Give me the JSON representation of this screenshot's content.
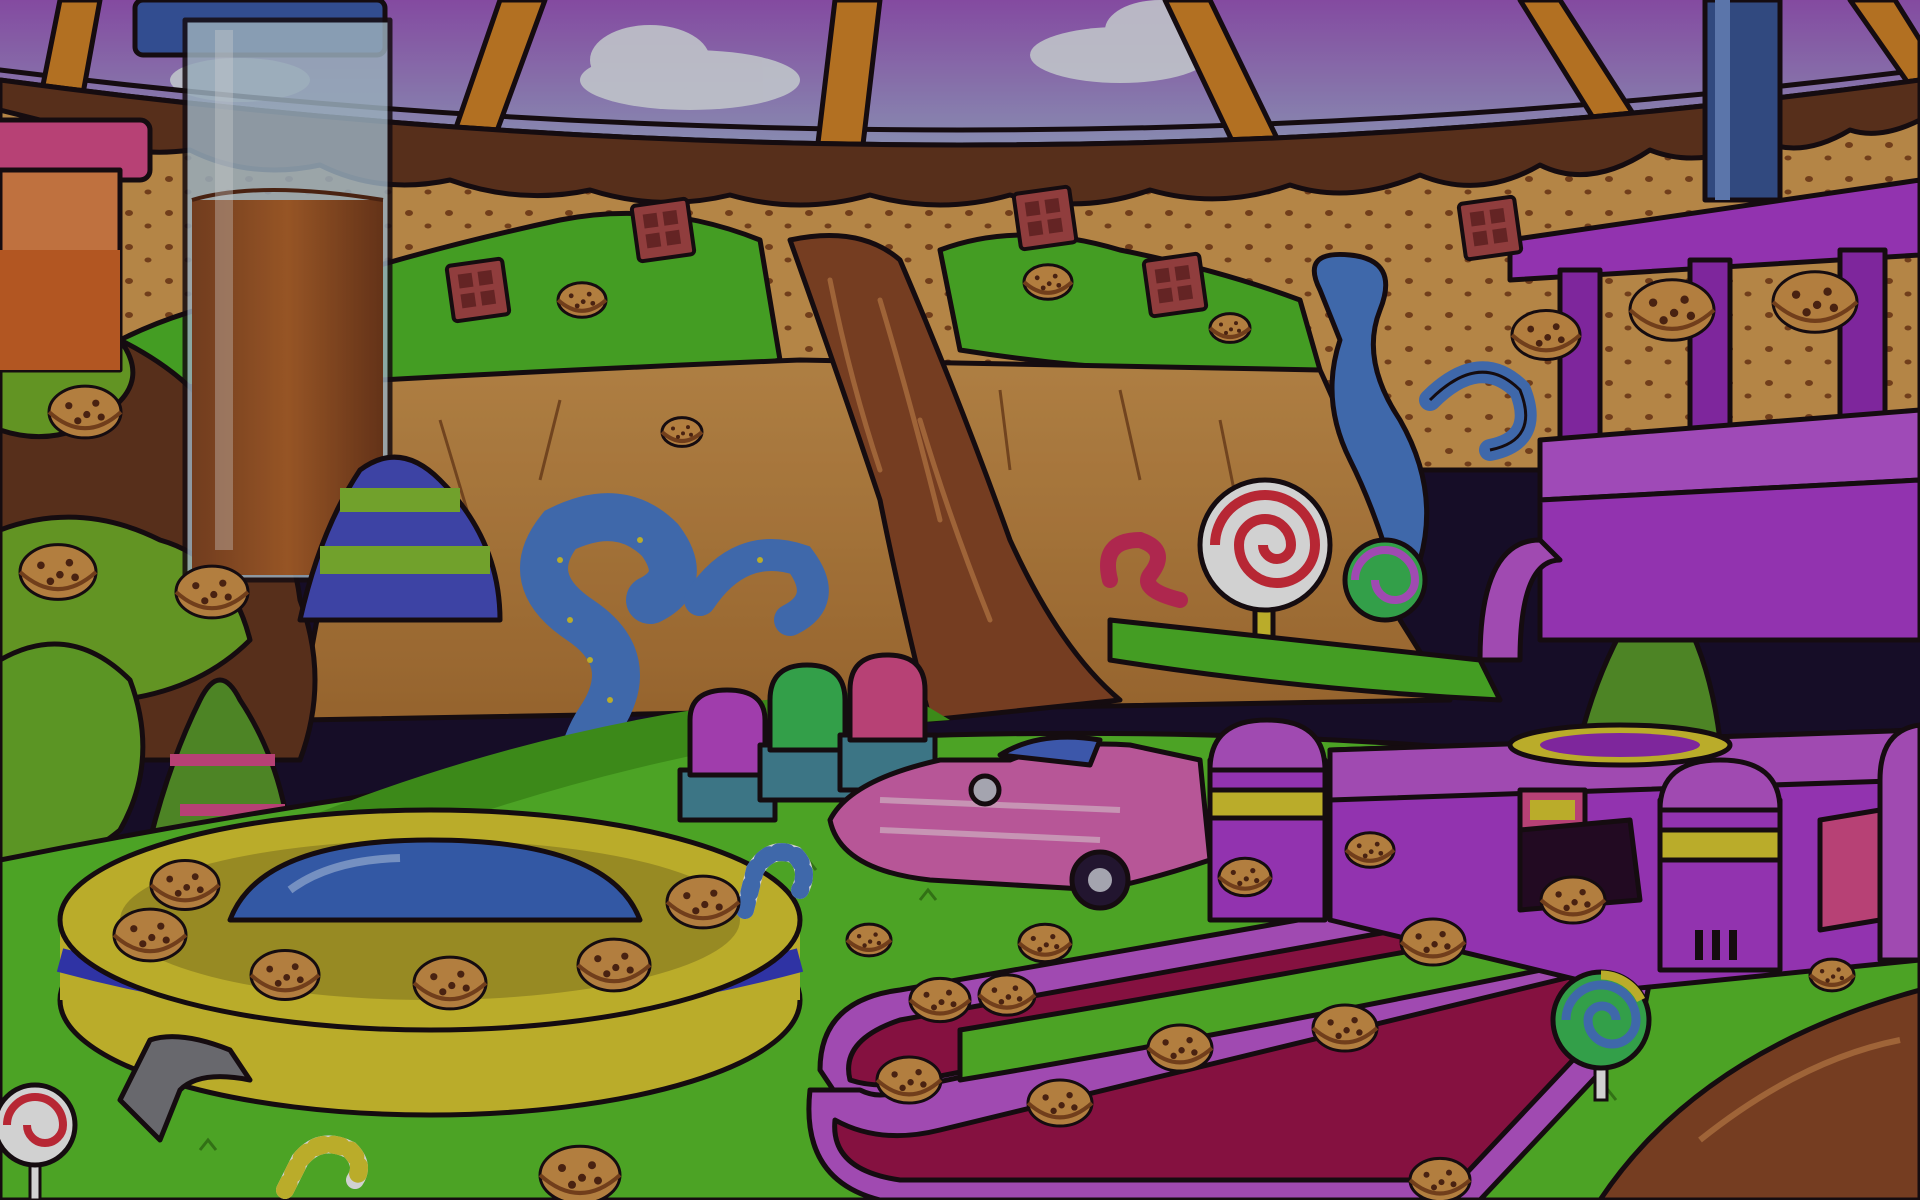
{
  "scene": {
    "kind": "candy-factory-hidden-object-background",
    "colors": {
      "sky_top": "#a25bc4",
      "sky_bottom": "#a7c8df",
      "dome_frame": "#d9892a",
      "chocolate": "#6b3a22",
      "cookie_dough": "#e2a559",
      "grass": "#53c02b",
      "factory_purple": "#b23fd6",
      "conveyor_belt": "#a3154f",
      "factory_yellow": "#e3d234",
      "ground": "#5dc72e"
    }
  },
  "objects": {
    "cookies": {
      "icon": "chocolate-chip-cookie",
      "count_visible": 36
    },
    "chocolate_bars": {
      "icon": "chocolate-bar",
      "count_visible": 5
    },
    "glass_tubes": {
      "icon": "glass-tube",
      "fill_level": 0.8
    },
    "lollipops": {
      "icon": "swirl-lollipop",
      "count_visible": 4
    },
    "candy_canes": {
      "icon": "candy-cane",
      "count_visible": 3
    },
    "jars": {
      "icon": "jelly-jar",
      "colors": [
        "#c44bd2",
        "#3fc25a",
        "#e0508f"
      ]
    },
    "car": {
      "icon": "pink-convertible-car"
    },
    "mixer": {
      "icon": "cookie-mixer-dome"
    },
    "factory": {
      "icon": "cookie-oven-factory"
    }
  }
}
